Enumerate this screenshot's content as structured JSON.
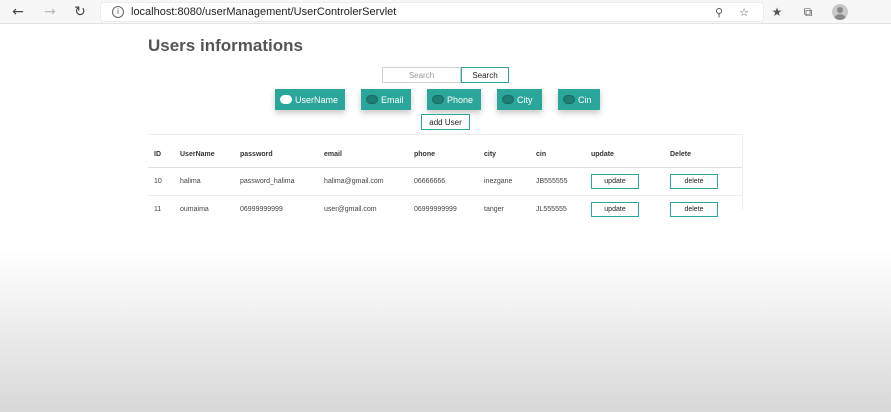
{
  "browser": {
    "url": "localhost:8080/userManagement/UserControlerServlet",
    "icons": {
      "back": "back-arrow-icon",
      "forward": "forward-arrow-icon",
      "refresh": "refresh-icon",
      "info": "info-icon",
      "zoom": "zoom-icon",
      "favorite_add": "star-plus-icon",
      "favorites": "favorites-icon",
      "collections": "collections-icon",
      "profile": "avatar"
    }
  },
  "page": {
    "title": "Users informations"
  },
  "search": {
    "placeholder": "Search",
    "button_label": "Search"
  },
  "filters": [
    {
      "label": "UserName",
      "active": true
    },
    {
      "label": "Email",
      "active": false
    },
    {
      "label": "Phone",
      "active": false
    },
    {
      "label": "City",
      "active": false
    },
    {
      "label": "Cin",
      "active": false
    }
  ],
  "add_user_label": "add User",
  "table": {
    "headers": [
      "ID",
      "UserName",
      "password",
      "email",
      "phone",
      "city",
      "cin",
      "update",
      "Delete"
    ],
    "rows": [
      {
        "id": "10",
        "username": "halima",
        "password": "password_halima",
        "email": "halima@gmail.com",
        "phone": "06666666",
        "city": "inezgane",
        "cin": "JB555555",
        "update": "update",
        "delete": "delete"
      },
      {
        "id": "11",
        "username": "oumaima",
        "password": "06999999999",
        "email": "user@gmail.com",
        "phone": "06999999999",
        "city": "tanger",
        "cin": "JL555555",
        "update": "update",
        "delete": "delete"
      }
    ]
  },
  "colors": {
    "accent": "#2aa69a",
    "title": "#555555"
  }
}
